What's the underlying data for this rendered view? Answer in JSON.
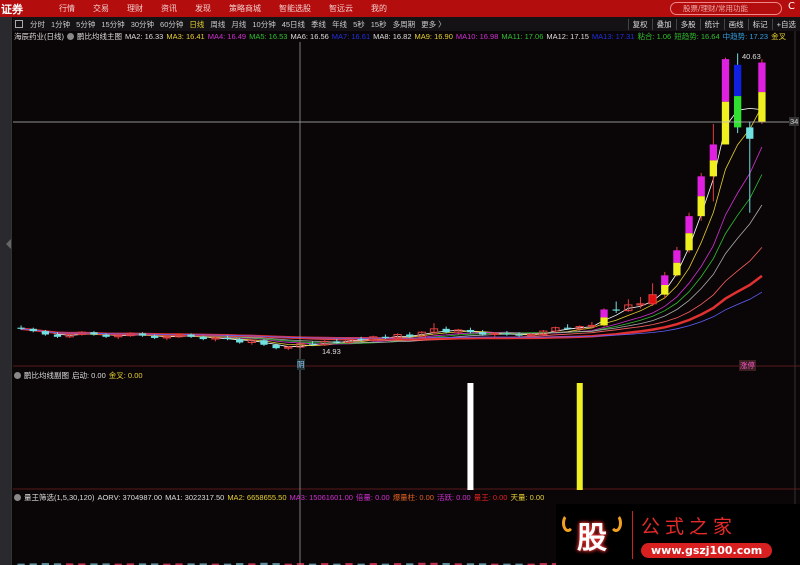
{
  "topbar": {
    "brand": "证券",
    "nav": [
      "行情",
      "交易",
      "理财",
      "资讯",
      "发现",
      "策略商城",
      "智能选股",
      "智远云",
      "我的"
    ],
    "search_placeholder": "股票/理财/常用功能"
  },
  "toolbar": {
    "periods": [
      "分时",
      "1分钟",
      "5分钟",
      "15分钟",
      "30分钟",
      "60分钟",
      "日线",
      "周线",
      "月线",
      "10分钟",
      "45日线",
      "季线",
      "年线",
      "5秒",
      "15秒",
      "多周期",
      "更多 〉"
    ],
    "active": "日线",
    "right": [
      "复权",
      "叠加",
      "多股",
      "统计",
      "画线",
      "标记",
      "+自选"
    ]
  },
  "main_info": {
    "stock": "海辰药业(日线)",
    "indicator": "鹏比均线主图",
    "items": [
      {
        "t": "MA2: 16.33",
        "c": "#dddddd"
      },
      {
        "t": "MA3: 16.41",
        "c": "#e6d030"
      },
      {
        "t": "MA4: 16.49",
        "c": "#d030d0"
      },
      {
        "t": "MA5: 16.53",
        "c": "#30c030"
      },
      {
        "t": "MA6: 16.56",
        "c": "#dddddd"
      },
      {
        "t": "MA7: 16.61",
        "c": "#2030e0"
      },
      {
        "t": "MA8: 16.82",
        "c": "#dddddd"
      },
      {
        "t": "MA9: 16.90",
        "c": "#e6d030"
      },
      {
        "t": "MA10: 16.98",
        "c": "#d030d0"
      },
      {
        "t": "MA11: 17.06",
        "c": "#30c030"
      },
      {
        "t": "MA12: 17.15",
        "c": "#dddddd"
      },
      {
        "t": "MA13: 17.31",
        "c": "#2030e0"
      },
      {
        "t": "粘合: 1.06",
        "c": "#30c030"
      },
      {
        "t": "短趋势: 16.64",
        "c": "#30c030"
      },
      {
        "t": "中趋势: 17.23",
        "c": "#30a0e0"
      },
      {
        "t": "金叉",
        "c": "#e6d030"
      }
    ]
  },
  "sub1": {
    "indicator": "鹏比均线副图",
    "items": [
      {
        "t": "启动: 0.00",
        "c": "#dddddd"
      },
      {
        "t": "金叉: 0.00",
        "c": "#e6d030"
      }
    ],
    "signals": [
      {
        "index": 37,
        "color": "#ffffff"
      },
      {
        "index": 46,
        "color": "#f0f020"
      }
    ]
  },
  "sub2": {
    "indicator": "量王筛选(1,5,30,120)",
    "items": [
      {
        "t": "AORV: 3704987.00",
        "c": "#dddddd"
      },
      {
        "t": "MA1: 3022317.50",
        "c": "#dddddd"
      },
      {
        "t": "MA2: 6658655.50",
        "c": "#e6d030"
      },
      {
        "t": "MA3: 15061601.00",
        "c": "#d030d0"
      },
      {
        "t": "倍量: 0.00",
        "c": "#d030d0"
      },
      {
        "t": "爆量柱: 0.00",
        "c": "#e06020"
      },
      {
        "t": "活跃: 0.00",
        "c": "#d030d0"
      },
      {
        "t": "量王: 0.00",
        "c": "#e02020"
      },
      {
        "t": "天量: 0.00",
        "c": "#e6d030"
      }
    ]
  },
  "labels": {
    "high": "40.63",
    "low": "14.93",
    "crosshair_price": "34",
    "crosshair_date": "阴",
    "limit_tag": "涨停"
  },
  "watermark": {
    "logo": "股",
    "title": "公式之家",
    "url": "www.gszj100.com"
  },
  "chart_data": {
    "type": "candlestick",
    "ylim": [
      14.5,
      41.3
    ],
    "candles": [
      [
        16.9,
        17.1,
        16.7,
        16.8
      ],
      [
        16.8,
        16.9,
        16.5,
        16.6
      ],
      [
        16.6,
        16.7,
        16.2,
        16.3
      ],
      [
        16.3,
        16.5,
        16.0,
        16.1
      ],
      [
        16.1,
        16.4,
        16.0,
        16.3
      ],
      [
        16.3,
        16.6,
        16.2,
        16.5
      ],
      [
        16.5,
        16.6,
        16.2,
        16.3
      ],
      [
        16.3,
        16.4,
        16.0,
        16.1
      ],
      [
        16.1,
        16.3,
        15.9,
        16.2
      ],
      [
        16.2,
        16.5,
        16.1,
        16.4
      ],
      [
        16.4,
        16.5,
        16.1,
        16.2
      ],
      [
        16.2,
        16.3,
        15.9,
        16.0
      ],
      [
        16.0,
        16.2,
        15.8,
        16.1
      ],
      [
        16.1,
        16.4,
        16.0,
        16.3
      ],
      [
        16.3,
        16.4,
        16.0,
        16.1
      ],
      [
        16.1,
        16.2,
        15.8,
        15.9
      ],
      [
        15.9,
        16.1,
        15.7,
        16.0
      ],
      [
        16.0,
        16.2,
        15.8,
        15.9
      ],
      [
        15.9,
        16.0,
        15.5,
        15.6
      ],
      [
        15.6,
        15.9,
        15.4,
        15.8
      ],
      [
        15.8,
        15.9,
        15.3,
        15.4
      ],
      [
        15.4,
        15.5,
        15.0,
        15.1
      ],
      [
        15.1,
        15.3,
        14.93,
        15.2
      ],
      [
        15.2,
        15.6,
        15.1,
        15.5
      ],
      [
        15.5,
        15.7,
        15.3,
        15.4
      ],
      [
        15.4,
        15.8,
        15.3,
        15.7
      ],
      [
        15.7,
        15.9,
        15.5,
        15.6
      ],
      [
        15.6,
        16.0,
        15.5,
        15.9
      ],
      [
        15.9,
        16.1,
        15.7,
        15.8
      ],
      [
        15.8,
        16.2,
        15.7,
        16.1
      ],
      [
        16.1,
        16.3,
        15.9,
        16.0
      ],
      [
        16.0,
        16.4,
        15.9,
        16.3
      ],
      [
        16.3,
        16.5,
        16.0,
        16.1
      ],
      [
        16.1,
        16.6,
        16.0,
        16.5
      ],
      [
        16.5,
        17.3,
        16.3,
        16.8
      ],
      [
        16.8,
        17.0,
        16.4,
        16.5
      ],
      [
        16.5,
        16.8,
        16.3,
        16.7
      ],
      [
        16.7,
        16.9,
        16.4,
        16.5
      ],
      [
        16.5,
        16.7,
        16.2,
        16.3
      ],
      [
        16.3,
        16.5,
        16.1,
        16.4
      ],
      [
        16.4,
        16.6,
        16.2,
        16.3
      ],
      [
        16.3,
        16.5,
        16.1,
        16.2
      ],
      [
        16.2,
        16.4,
        16.0,
        16.3
      ],
      [
        16.3,
        16.7,
        16.2,
        16.6
      ],
      [
        16.6,
        17.0,
        16.5,
        16.9
      ],
      [
        16.9,
        17.2,
        16.7,
        16.8
      ],
      [
        16.8,
        17.1,
        16.6,
        17.0
      ],
      [
        17.0,
        17.4,
        16.8,
        17.1
      ],
      [
        17.1,
        18.6,
        17.0,
        18.5
      ],
      [
        18.5,
        19.2,
        18.2,
        18.4
      ],
      [
        18.4,
        19.4,
        18.3,
        18.9
      ],
      [
        18.9,
        19.6,
        18.6,
        19.0
      ],
      [
        19.0,
        20.8,
        18.8,
        19.8
      ],
      [
        19.8,
        21.8,
        19.5,
        21.5
      ],
      [
        21.5,
        24.0,
        21.4,
        23.7
      ],
      [
        23.7,
        27.0,
        23.5,
        26.7
      ],
      [
        26.7,
        30.5,
        26.3,
        30.2
      ],
      [
        30.2,
        34.8,
        28.0,
        33.0
      ],
      [
        33.0,
        40.63,
        33.0,
        40.5
      ],
      [
        40.0,
        41.0,
        34.0,
        34.5
      ],
      [
        34.5,
        35.0,
        27.0,
        33.5
      ],
      [
        35.0,
        40.5,
        34.8,
        40.2
      ]
    ],
    "ma_periods": [
      3,
      5,
      8,
      10,
      13,
      20,
      30,
      40
    ],
    "ma_colors": [
      "#ffffff",
      "#e6d030",
      "#d030d0",
      "#30c030",
      "#aaaaaa",
      "#ff6060",
      "#e33030",
      "#6060ff"
    ]
  }
}
